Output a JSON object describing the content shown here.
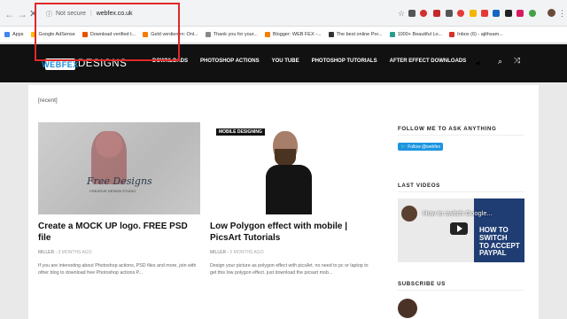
{
  "browser": {
    "back_icon": "arrow-left-icon",
    "forward_icon": "arrow-right-icon",
    "reload_icon": "close-icon",
    "security_label": "Not secure",
    "url": "webfex.co.uk",
    "bookmarks": [
      {
        "label": "Apps",
        "color": "#4285f4"
      },
      {
        "label": "Google AdSense",
        "color": "#fbbc05"
      },
      {
        "label": "Download verified t...",
        "color": "#e65100"
      },
      {
        "label": "Geld verdienen: Onl...",
        "color": "#f57c00"
      },
      {
        "label": "Thank you for your...",
        "color": "#888888"
      },
      {
        "label": "Blogger: WEB FEX -...",
        "color": "#f57d00"
      },
      {
        "label": "The best online Por...",
        "color": "#333333"
      },
      {
        "label": "1000+ Beautiful Lo...",
        "color": "#2a9d8f"
      },
      {
        "label": "Inbox (6) - ajithsam...",
        "color": "#d93025"
      }
    ],
    "menu_icon": "vertical-dots-icon"
  },
  "site": {
    "logo_text": "WEBFEX",
    "logo_suffix": "DESIGNS",
    "nav": [
      "DOWNLOADS",
      "PHOTOSHOP ACTIONS",
      "YOU TUBE",
      "PHOTOSHOP TUTORIALS",
      "AFTER EFFECT DOWNLOADS"
    ],
    "search_icon": "search-icon",
    "shuffle_icon": "shuffle-icon"
  },
  "main": {
    "recent_tag": "[recent]",
    "posts": [
      {
        "image_text": "Free Designs",
        "image_subtext": "CREATIVE DESIGN STUDIO",
        "title": "Create a MOCK UP logo. FREE PSD file",
        "author": "MILLER",
        "date": "3 MONTHS AGO",
        "excerpt": "If you are interesting about Photoshop actions, PSD files and more, join with other blog to download free Photoshop actions P..."
      },
      {
        "badge": "MOBILE DESIGNING",
        "title": "Low Polygon effect with mobile | PicsArt Tutorials",
        "author": "MILLER",
        "date": "5 MONTHS AGO",
        "excerpt": "Design your picture as polygon effect with picsArt. no need to pc or laptop to get this low polygon effect. just download the picsart mob..."
      }
    ]
  },
  "sidebar": {
    "follow_heading": "FOLLOW ME TO ASK ANYTHING",
    "twitter_button": "Follow @webfex",
    "videos_heading": "LAST VIDEOS",
    "video_title": "How to switch Google...",
    "video_overlay_lines": [
      "HOW TO",
      "SWITCH",
      "TO ACCEPT",
      "PAYPAL"
    ],
    "subscribe_heading": "SUBSCRIBE US"
  }
}
